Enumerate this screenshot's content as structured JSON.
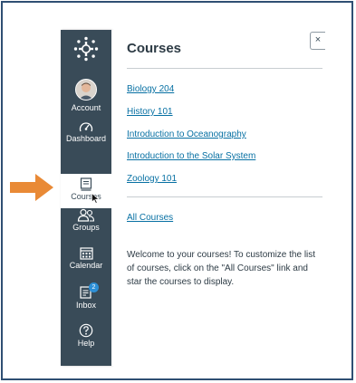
{
  "colors": {
    "nav_bg": "#394b58",
    "link": "#0770a3",
    "arrow": "#e98a36",
    "badge": "#2d8fd5",
    "frame": "#2f4f73"
  },
  "nav": {
    "items": [
      {
        "label": "Account",
        "icon": "avatar"
      },
      {
        "label": "Dashboard",
        "icon": "dashboard-icon"
      },
      {
        "label": "Courses",
        "icon": "courses-icon",
        "active": true
      },
      {
        "label": "Groups",
        "icon": "groups-icon"
      },
      {
        "label": "Calendar",
        "icon": "calendar-icon"
      },
      {
        "label": "Inbox",
        "icon": "inbox-icon",
        "badge": "2"
      },
      {
        "label": "Help",
        "icon": "help-icon"
      }
    ]
  },
  "tray": {
    "title": "Courses",
    "close_symbol": "×",
    "courses": [
      "Biology 204",
      "History 101",
      "Introduction to Oceanography",
      "Introduction to the Solar System",
      "Zoology 101"
    ],
    "all_courses": "All Courses",
    "welcome_text": "Welcome to your courses! To customize the list of courses, click on the \"All Courses\" link and star the courses to display."
  }
}
